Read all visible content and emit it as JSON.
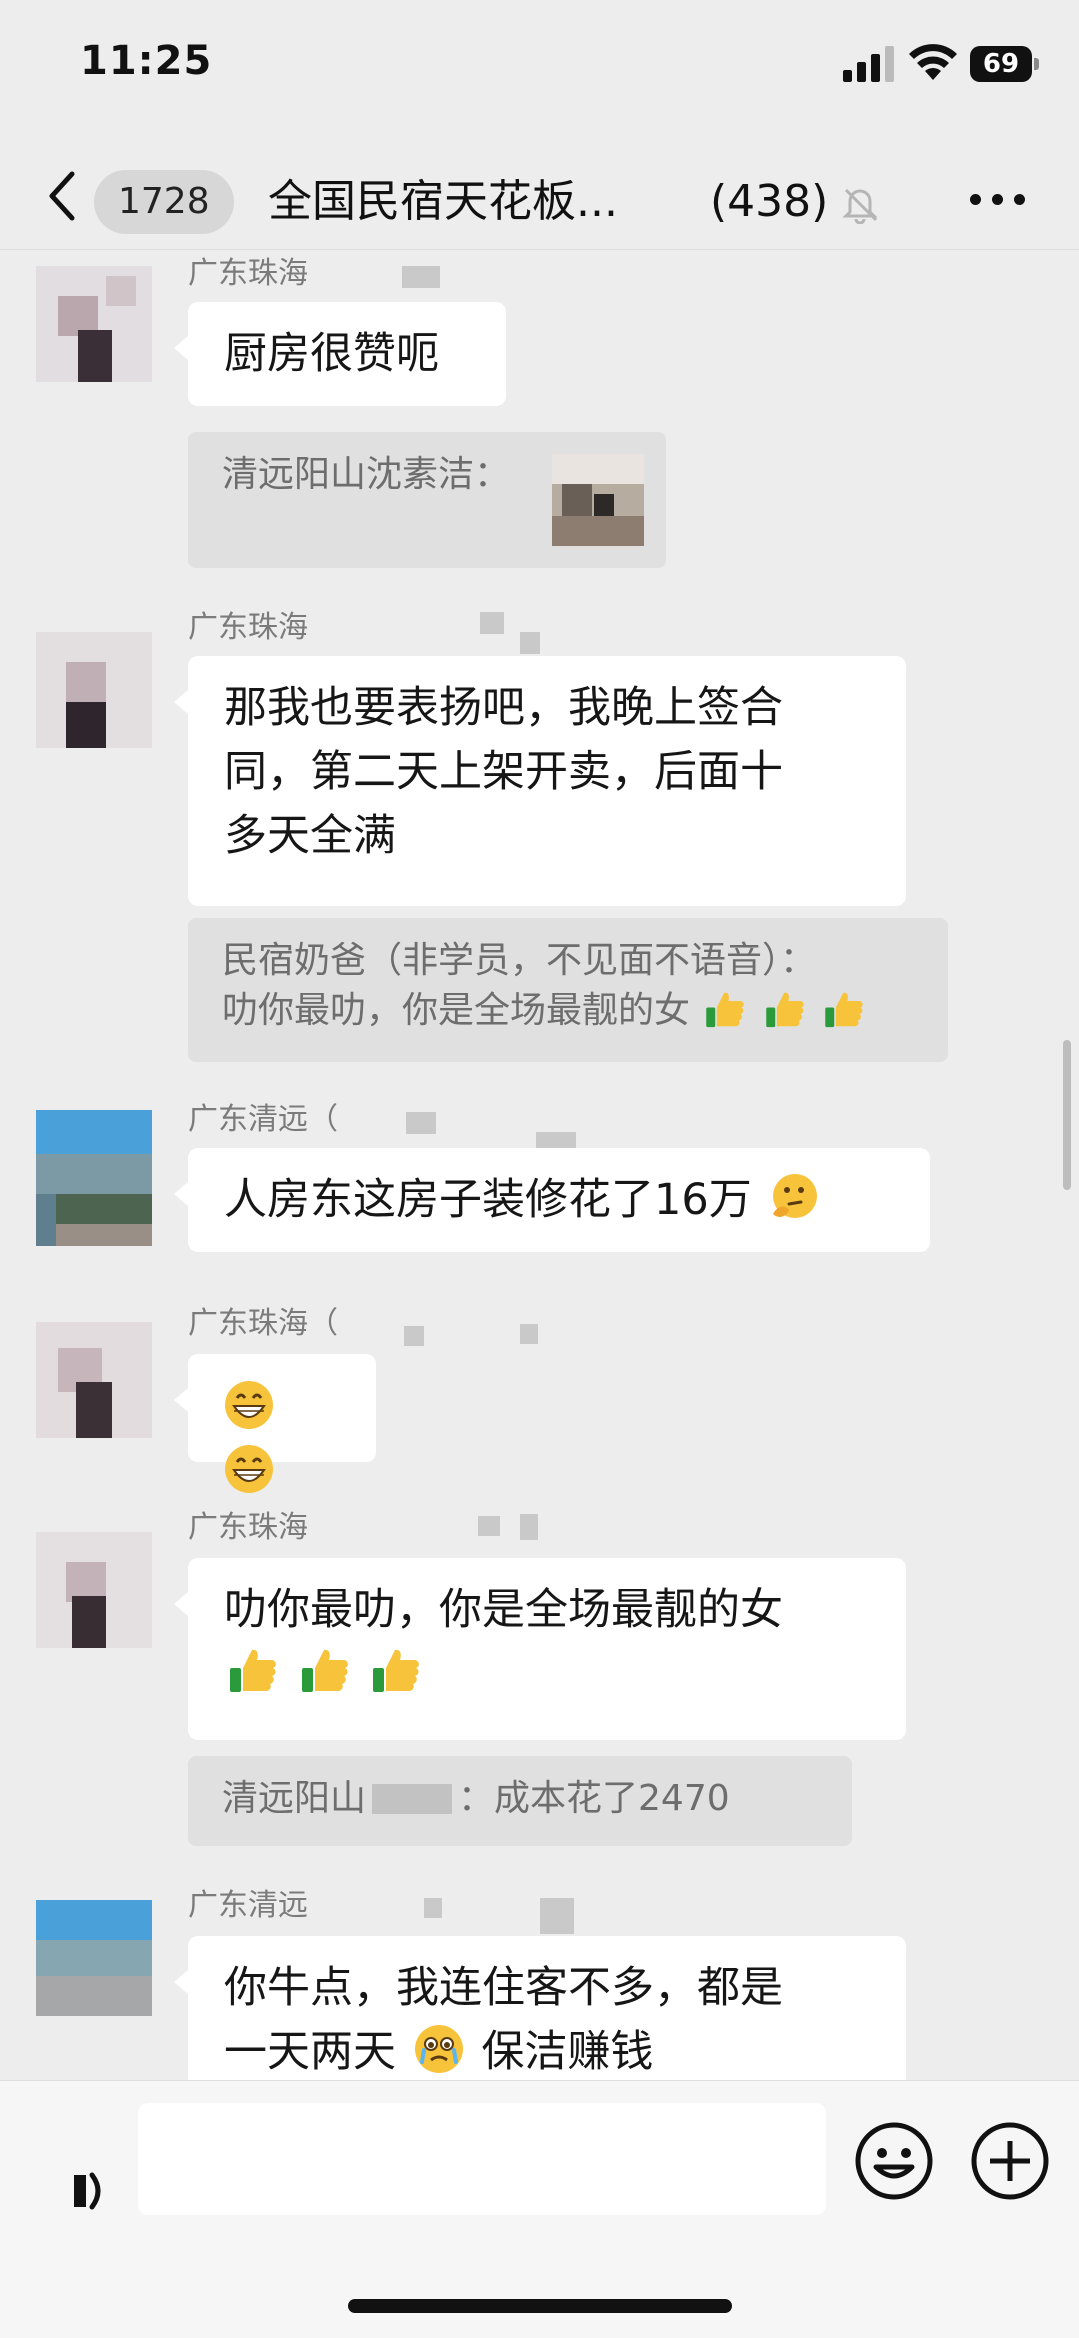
{
  "status_bar": {
    "time": "11:25",
    "battery": "69"
  },
  "header": {
    "unread_count": "1728",
    "group_title": "全国民宿天花板...",
    "member_count": "(438)",
    "icons": {
      "back": "chevron-left-icon",
      "mute": "bell-slash-icon",
      "more": "more-icon"
    }
  },
  "messages": [
    {
      "sender": "广东珠海",
      "text": "厨房很赞呃"
    },
    {
      "quote_author": "清远阳山沈素洁："
    },
    {
      "sender": "广东珠海",
      "lines": [
        "那我也要表扬吧，我晚上签合",
        "同，第二天上架开卖，后面十",
        "多天全满"
      ]
    },
    {
      "quote_lines": [
        "民宿奶爸（非学员，不见面不语音）：",
        "叻你最叻，你是全场最靓的女"
      ],
      "quote_emoji": "thumbs-up-icon"
    },
    {
      "sender": "广东清远（",
      "text": "人房东这房子装修花了16万",
      "emoji": "thinking-face-icon"
    },
    {
      "sender": "广东珠海（",
      "emoji": "grin-icon"
    },
    {
      "sender": "广东珠海",
      "text": "叻你最叻，你是全场最靓的女",
      "emoji": "thumbs-up-icon"
    },
    {
      "quote_part1": "清远阳山",
      "quote_part2": "：成本花了2470"
    },
    {
      "sender": "广东清远",
      "line1": "你牛点，我连住客不多，都是",
      "line2a": "一天两天",
      "line2b": "保洁赚钱",
      "emoji": "crying-face-icon"
    }
  ],
  "input_bar": {
    "placeholder": "",
    "icons": {
      "voice": "voice-icon",
      "emoji": "smiley-icon",
      "add": "plus-circle-icon"
    }
  },
  "colors": {
    "background": "#ededed",
    "bubble": "#ffffff",
    "quote": "#e0e0e0"
  }
}
